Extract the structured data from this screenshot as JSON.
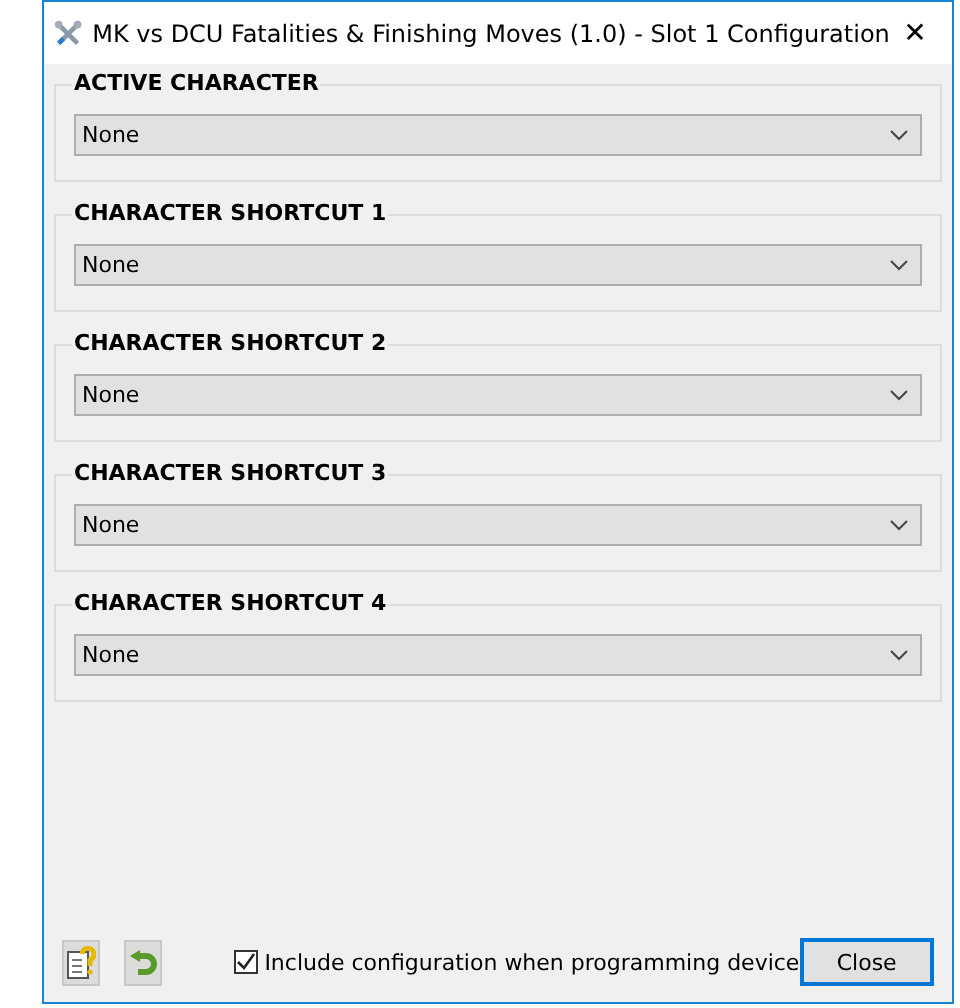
{
  "window": {
    "title": "MK vs DCU Fatalities & Finishing Moves (1.0) - Slot 1 Configuration",
    "close_glyph": "✕"
  },
  "groups": [
    {
      "label": "ACTIVE CHARACTER",
      "value": "None"
    },
    {
      "label": "CHARACTER SHORTCUT 1",
      "value": "None"
    },
    {
      "label": "CHARACTER SHORTCUT 2",
      "value": "None"
    },
    {
      "label": "CHARACTER SHORTCUT 3",
      "value": "None"
    },
    {
      "label": "CHARACTER SHORTCUT 4",
      "value": "None"
    }
  ],
  "footer": {
    "include_checkbox": {
      "label": "Include configuration when programming device",
      "checked": true
    },
    "close_button": "Close"
  }
}
